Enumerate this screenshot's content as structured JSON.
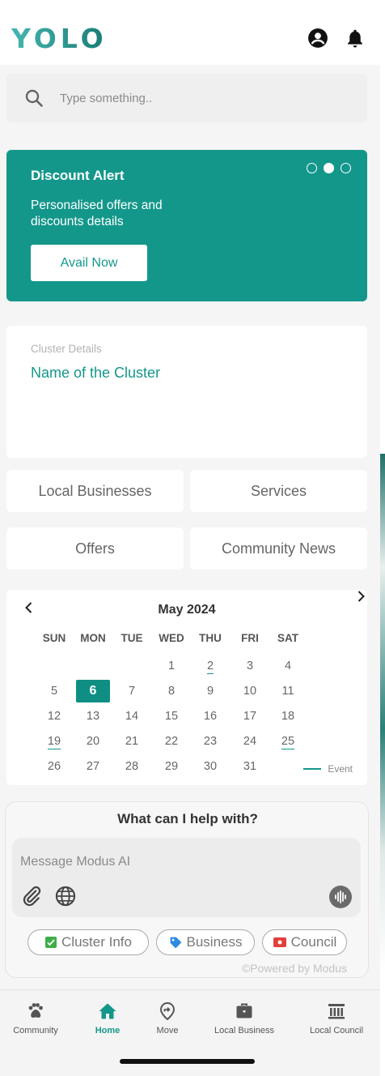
{
  "app": {
    "logo": "YOLO"
  },
  "header": {
    "profile_icon": "account-circle-icon",
    "notification_icon": "bell-icon"
  },
  "search": {
    "placeholder": "Type something.."
  },
  "banner": {
    "title": "Discount Alert",
    "description": "Personalised offers and discounts details",
    "button_label": "Avail Now",
    "carousel_dots": 3,
    "active_dot": 2,
    "color": "#14978b"
  },
  "cluster": {
    "label": "Cluster Details",
    "name": "Name of the Cluster"
  },
  "tiles": {
    "local_businesses": "Local Businesses",
    "services": "Services",
    "offers": "Offers",
    "community_news": "Community News"
  },
  "calendar": {
    "title": "May 2024",
    "weekdays": [
      "SUN",
      "MON",
      "TUE",
      "WED",
      "THU",
      "FRI",
      "SAT"
    ],
    "first_weekday_index": 3,
    "days_in_month": 31,
    "selected_day": 6,
    "event_days": [
      2,
      19,
      25
    ],
    "legend_label": "Event"
  },
  "ai": {
    "title": "What can I help with?",
    "placeholder": "Message Modus AI",
    "chips": {
      "cluster_info": "Cluster Info",
      "business": "Business",
      "council": "Council"
    },
    "powered_by": "©Powered by Modus"
  },
  "nav": {
    "community": "Community",
    "home": "Home",
    "move": "Move",
    "local_business": "Local Business",
    "local_council": "Local Council",
    "active": "home"
  }
}
